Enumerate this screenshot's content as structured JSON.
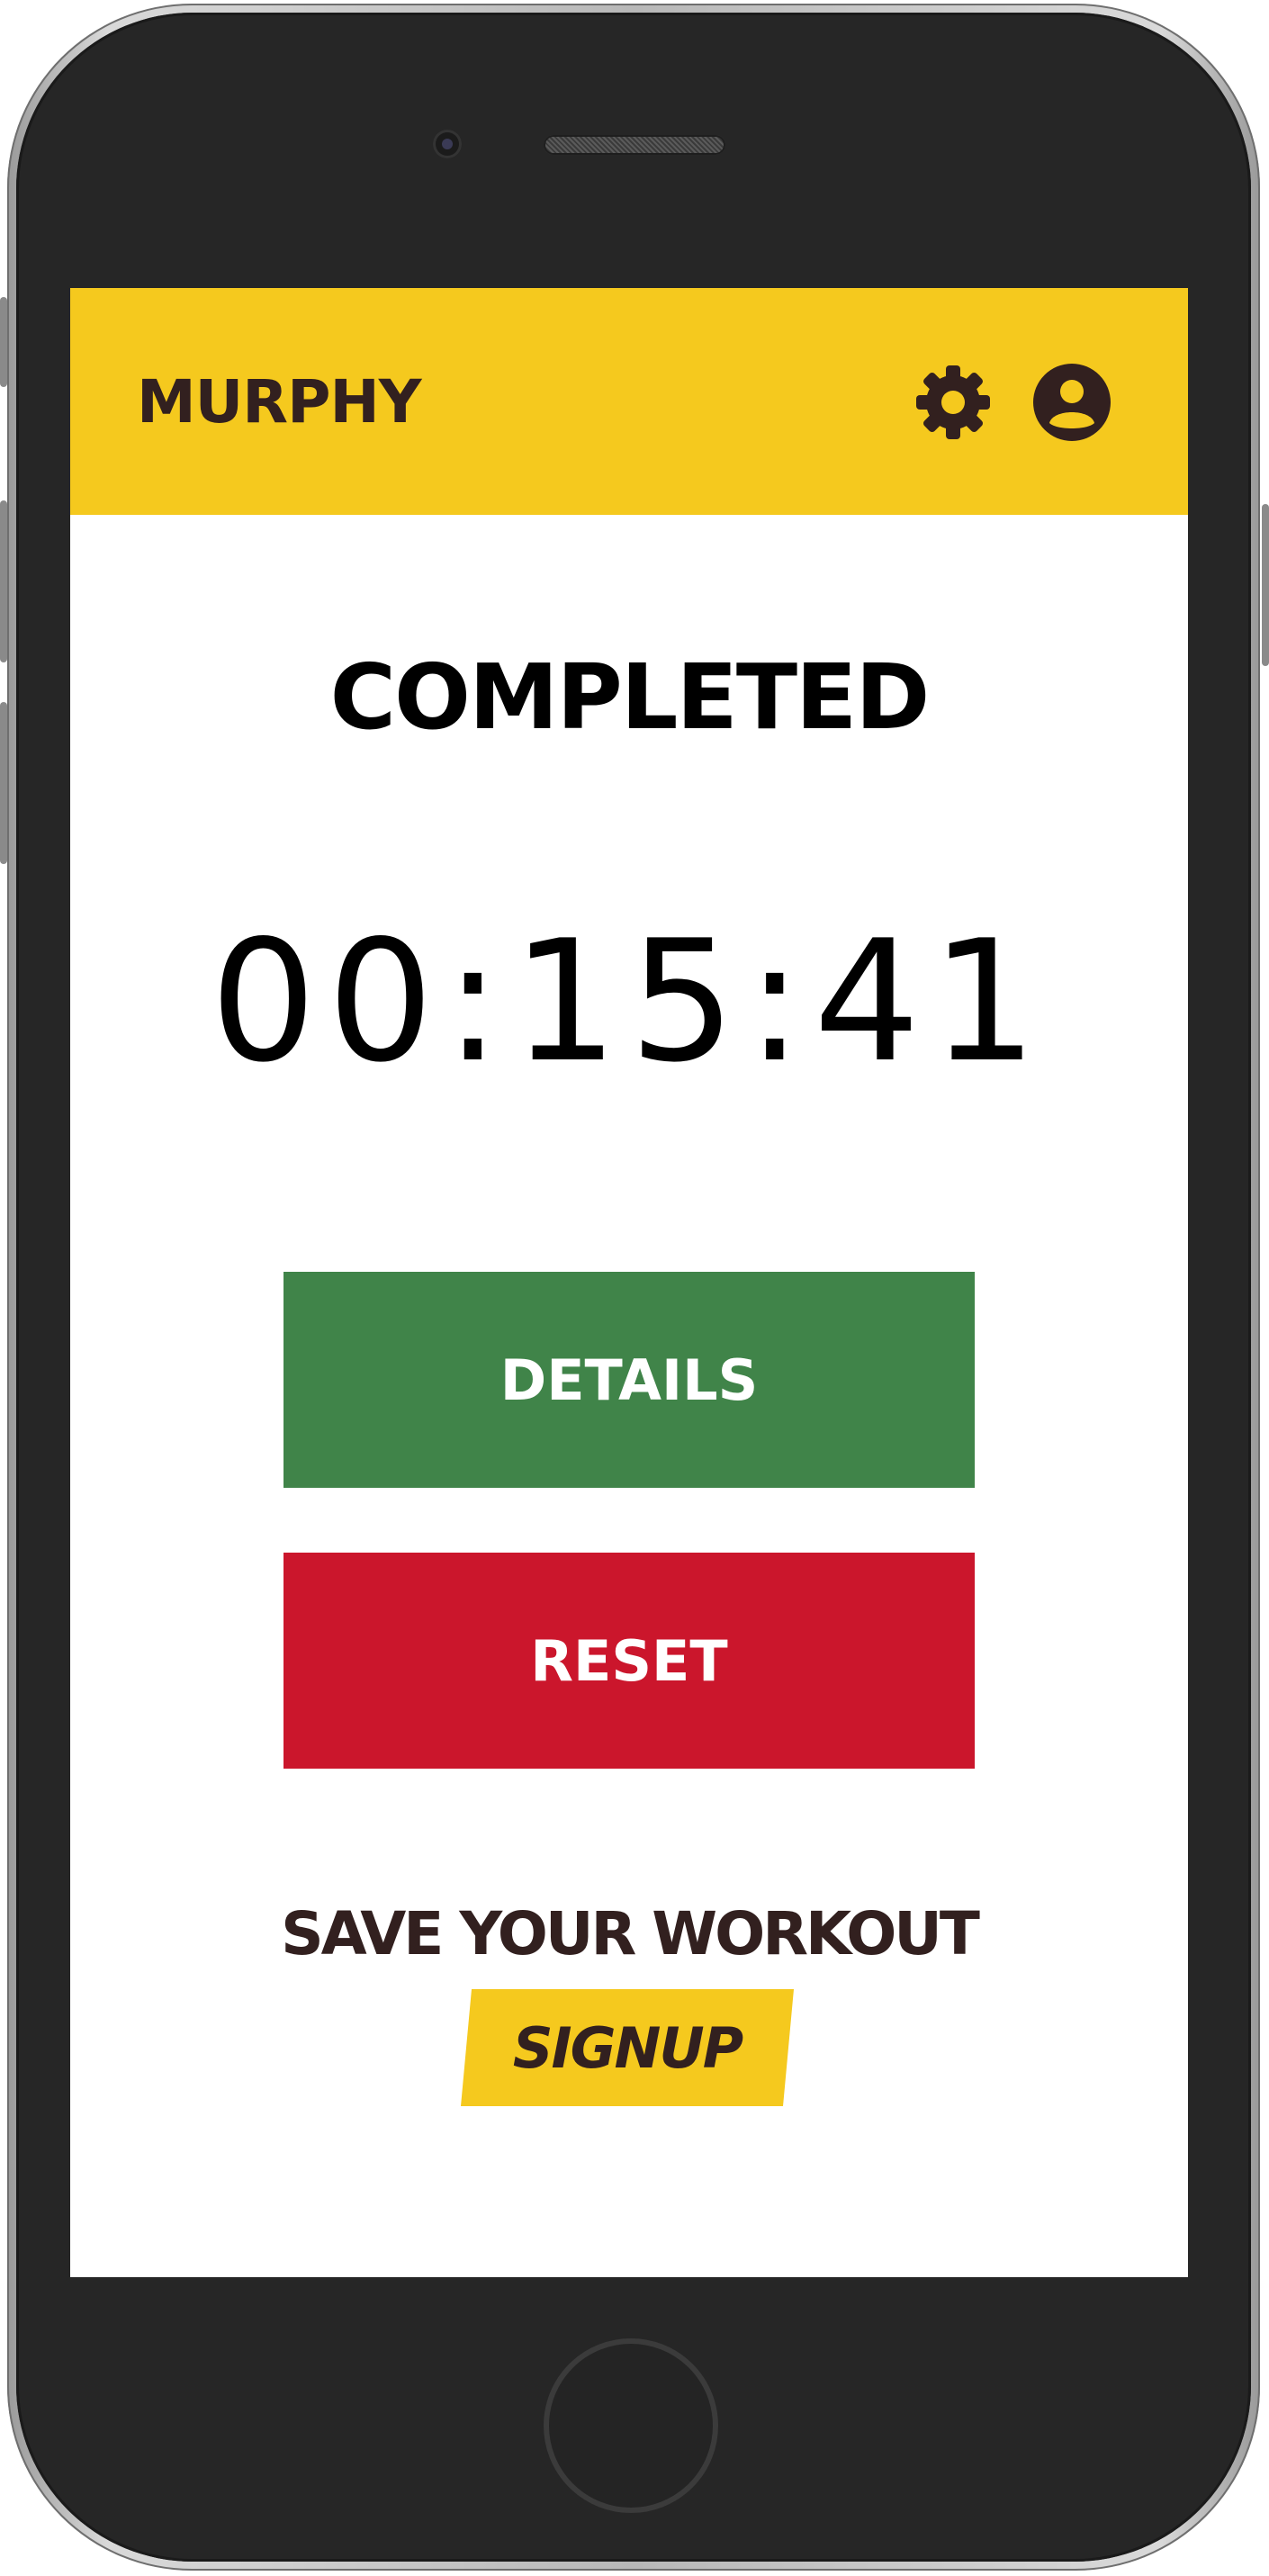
{
  "app": {
    "brand": "MURPHY"
  },
  "header": {
    "settings_icon": "gear-icon",
    "account_icon": "account-circle-icon"
  },
  "main": {
    "status": "COMPLETED",
    "timer": "00:15:41",
    "details_label": "DETAILS",
    "reset_label": "RESET",
    "save_prompt": "SAVE YOUR WORKOUT",
    "signup_label": "SIGNUP"
  },
  "colors": {
    "brand_yellow": "#f5c91e",
    "dark_brown": "#32201f",
    "details_green": "#408449",
    "reset_red": "#cb162c"
  }
}
